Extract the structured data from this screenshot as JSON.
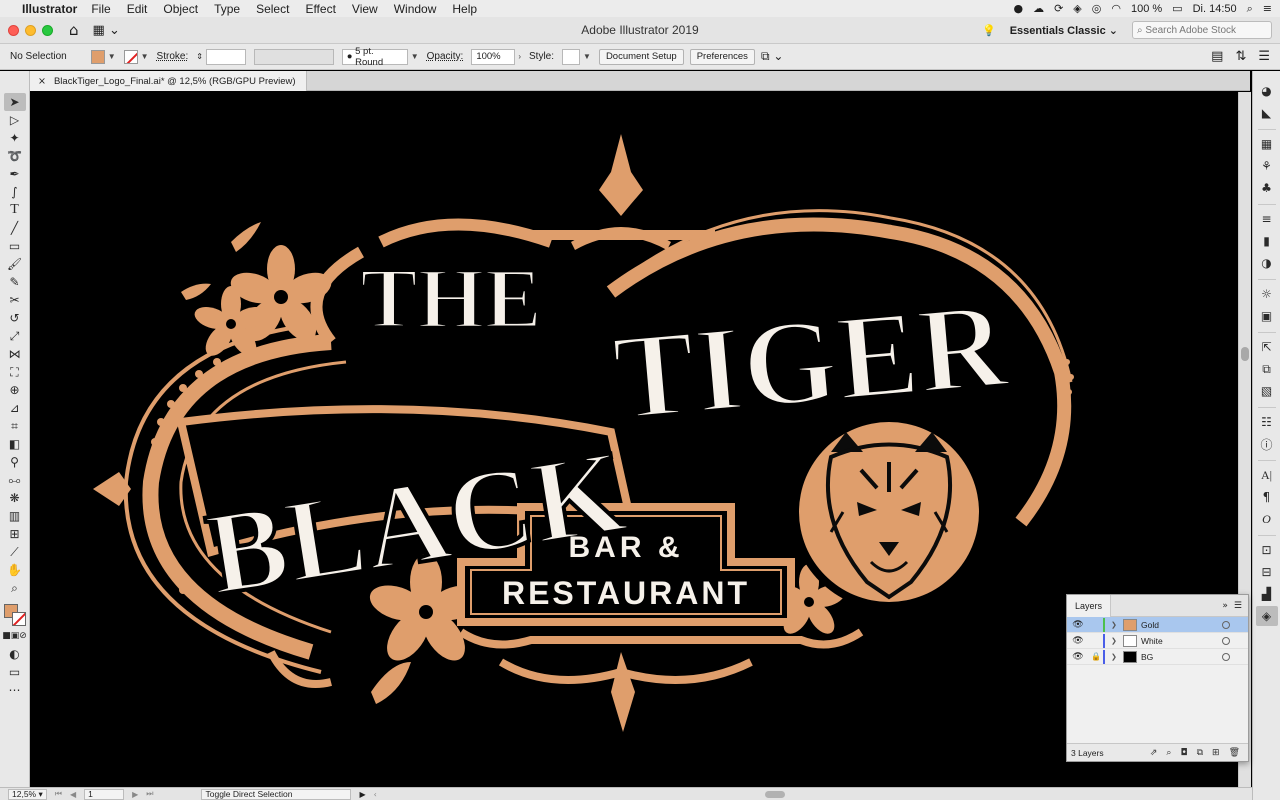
{
  "menubar": {
    "apple_icon": "",
    "app_name": "Illustrator",
    "menus": [
      "File",
      "Edit",
      "Object",
      "Type",
      "Select",
      "Effect",
      "View",
      "Window",
      "Help"
    ],
    "battery": "100 %",
    "clock": "Di. 14:50"
  },
  "titlebar": {
    "title": "Adobe Illustrator 2019",
    "workspace": "Essentials Classic",
    "stock_search_placeholder": "Search Adobe Stock"
  },
  "controlbar": {
    "selection_label": "No Selection",
    "stroke_label": "Stroke:",
    "brush_value": "5 pt. Round",
    "opacity_label": "Opacity:",
    "opacity_value": "100%",
    "style_label": "Style:",
    "document_setup": "Document Setup",
    "preferences": "Preferences",
    "fill_color": "#df9e6c"
  },
  "document": {
    "tab_title": "BlackTiger_Logo_Final.ai* @ 12,5% (RGB/GPU Preview)",
    "close": "×"
  },
  "artwork": {
    "line1": "THE",
    "line2": "BLACK",
    "line3": "TIGER",
    "line4": "BAR &",
    "line5": "RESTAURANT",
    "gold": "#df9e6c",
    "cream": "#f6f1ea"
  },
  "statusbar": {
    "zoom": "12,5%",
    "artboard": "1",
    "tool_hint": "Toggle Direct Selection"
  },
  "layers": {
    "tab": "Layers",
    "items": [
      {
        "name": "Gold",
        "color": "#4cc04c",
        "thumb": "#df9e6c",
        "selected": true,
        "locked": false
      },
      {
        "name": "White",
        "color": "#4a5ee8",
        "thumb": "#ffffff",
        "selected": false,
        "locked": false
      },
      {
        "name": "BG",
        "color": "#4a5ee8",
        "thumb": "#000000",
        "selected": false,
        "locked": true
      }
    ],
    "count": "3 Layers"
  }
}
